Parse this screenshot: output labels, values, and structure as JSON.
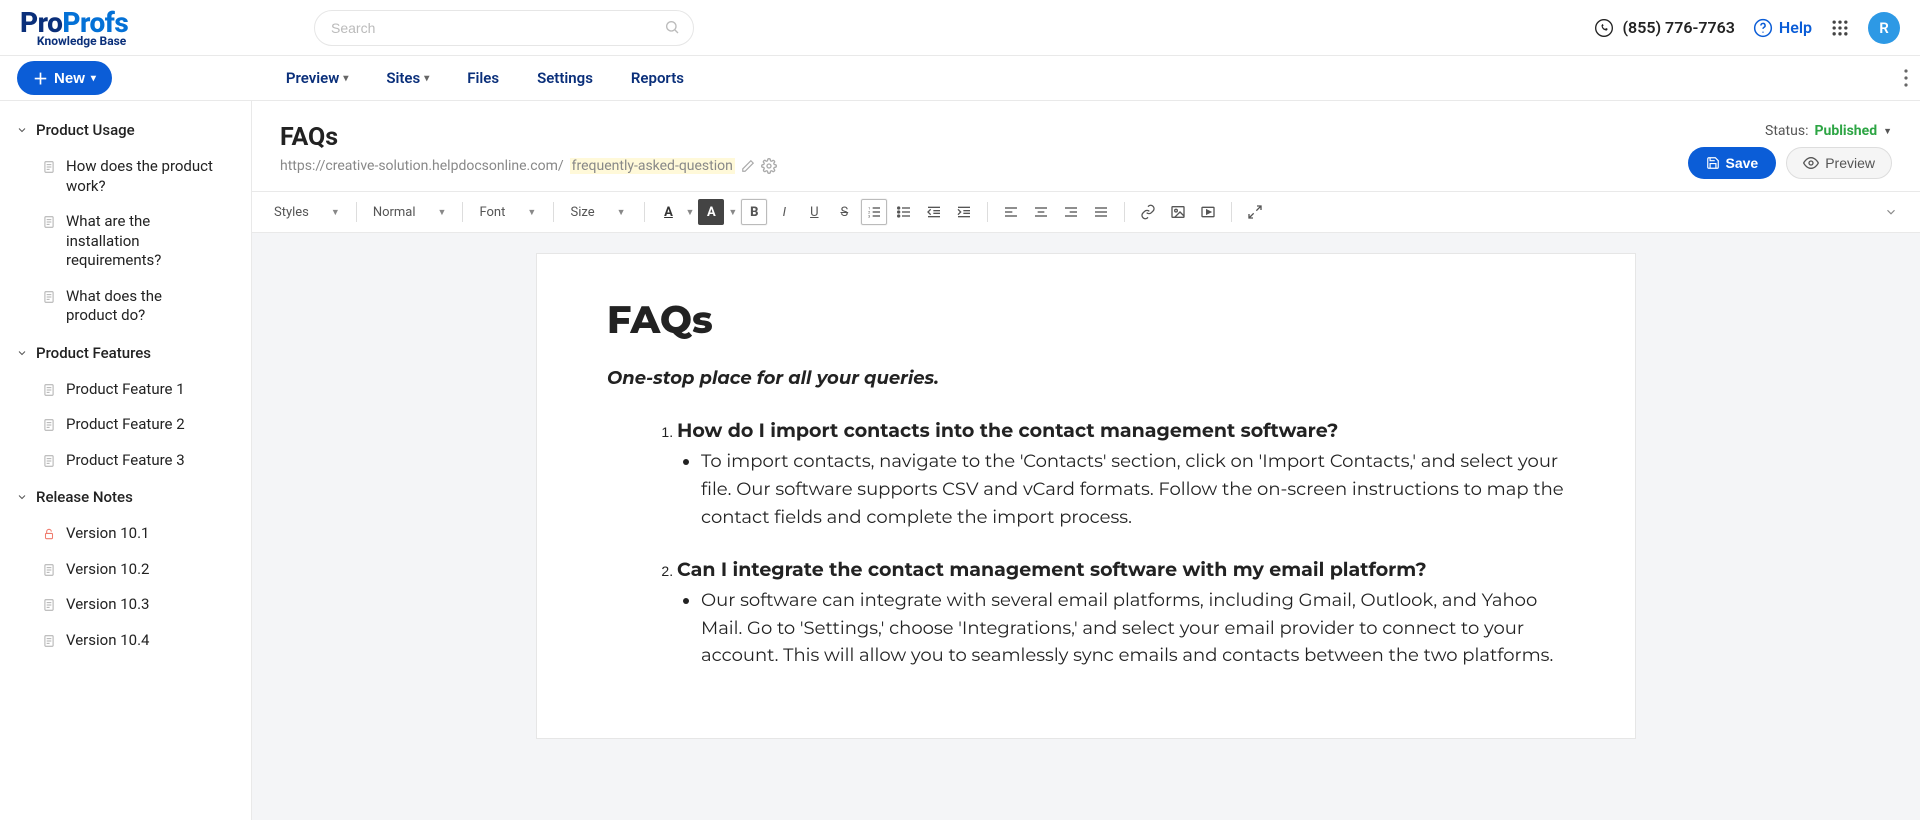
{
  "brand": {
    "pro": "Pro",
    "profs": "Profs",
    "sub": "Knowledge Base"
  },
  "search": {
    "placeholder": "Search"
  },
  "top": {
    "phone": "(855) 776-7763",
    "help": "Help",
    "avatar": "R"
  },
  "newbtn": {
    "label": "New"
  },
  "nav": {
    "preview": "Preview",
    "sites": "Sites",
    "files": "Files",
    "settings": "Settings",
    "reports": "Reports"
  },
  "sidebar": {
    "groups": [
      {
        "title": "Product Usage",
        "items": [
          {
            "label": "How does the product work?"
          },
          {
            "label": "What are the installation requirements?"
          },
          {
            "label": "What does the product do?"
          }
        ]
      },
      {
        "title": "Product Features",
        "items": [
          {
            "label": "Product Feature 1"
          },
          {
            "label": "Product Feature 2"
          },
          {
            "label": "Product Feature 3"
          }
        ]
      },
      {
        "title": "Release Notes",
        "items": [
          {
            "label": "Version 10.1",
            "locked": true
          },
          {
            "label": "Version 10.2"
          },
          {
            "label": "Version 10.3"
          },
          {
            "label": "Version 10.4"
          }
        ]
      }
    ]
  },
  "page": {
    "title": "FAQs",
    "url_base": "https://creative-solution.helpdocsonline.com/",
    "url_slug": "frequently-asked-question",
    "status_label": "Status:",
    "status_value": "Published",
    "save": "Save",
    "preview": "Preview"
  },
  "toolbar": {
    "styles": "Styles",
    "format": "Normal",
    "font": "Font",
    "size": "Size"
  },
  "doc": {
    "heading": "FAQs",
    "subtitle": "One-stop place for all your queries.",
    "faqs": [
      {
        "q": "How do I import contacts into the contact management software?",
        "a": "To import contacts, navigate to the 'Contacts' section, click on 'Import Contacts,' and select your file. Our software supports CSV and vCard formats. Follow the on-screen instructions to map the contact fields and complete the import process."
      },
      {
        "q": "Can I integrate the contact management software with my email platform?",
        "a": "Our software can integrate with several email platforms, including Gmail, Outlook, and Yahoo Mail. Go to 'Settings,' choose 'Integrations,' and select your email provider to connect to your account. This will allow you to seamlessly sync emails and contacts between the two platforms."
      }
    ]
  }
}
